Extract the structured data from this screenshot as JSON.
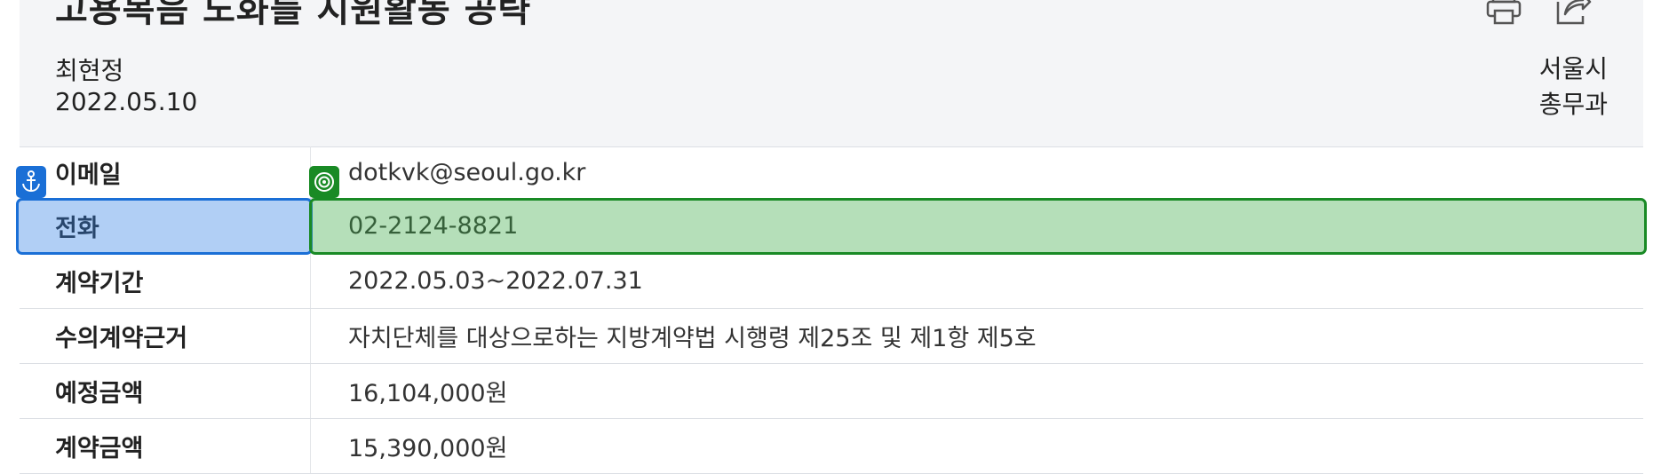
{
  "header": {
    "title": "고용복음 노화를 지원활동 공략",
    "author": "최현정",
    "date": "2022.05.10",
    "dept_line1": "서울시",
    "dept_line2": "총무과",
    "print_icon": "print-icon",
    "share_icon": "share-icon"
  },
  "table": {
    "rows": [
      {
        "label": "이메일",
        "value": "dotkvk@seoul.go.kr"
      },
      {
        "label": "전화",
        "value": "02-2124-8821"
      },
      {
        "label": "계약기간",
        "value": "2022.05.03~2022.07.31"
      },
      {
        "label": "수의계약근거",
        "value": "자치단체를 대상으로하는 지방계약법 시행령 제25조 및 제1항 제5호"
      },
      {
        "label": "예정금액",
        "value": "16,104,000원"
      },
      {
        "label": "계약금액",
        "value": "15,390,000원"
      }
    ]
  },
  "highlights": {
    "anchor_icon": "anchor-icon",
    "target_icon": "target-icon",
    "anchor_color": "#1a6fd6",
    "target_color": "#198a25"
  }
}
